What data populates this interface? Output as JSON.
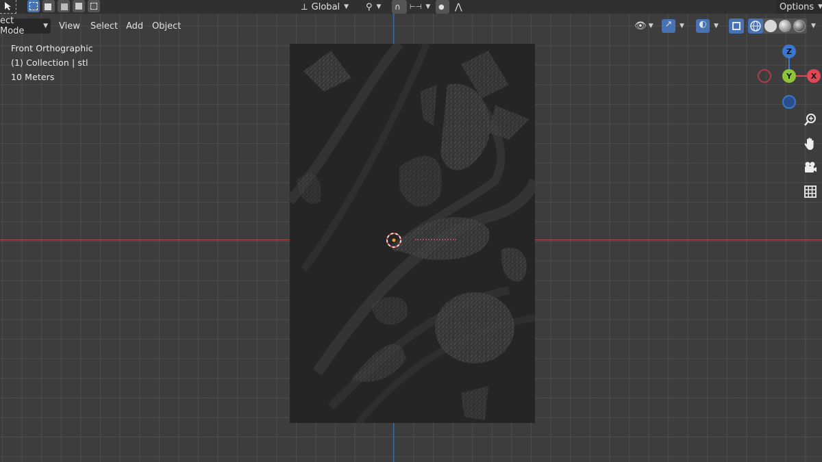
{
  "header": {
    "transform_orientation": "Global",
    "options_label": "Options"
  },
  "menu": {
    "mode_label": "ect Mode",
    "items": [
      "View",
      "Select",
      "Add",
      "Object"
    ]
  },
  "overlay_info": {
    "view_name": "Front Orthographic",
    "collection": "(1) Collection | stl",
    "scale": "10 Meters"
  },
  "gizmo": {
    "z_label": "Z",
    "y_label": "Y",
    "x_label": "X"
  },
  "colors": {
    "x_axis": "#e04858",
    "y_axis": "#8fc43a",
    "z_axis": "#3a78d0",
    "accent": "#4772b3"
  }
}
